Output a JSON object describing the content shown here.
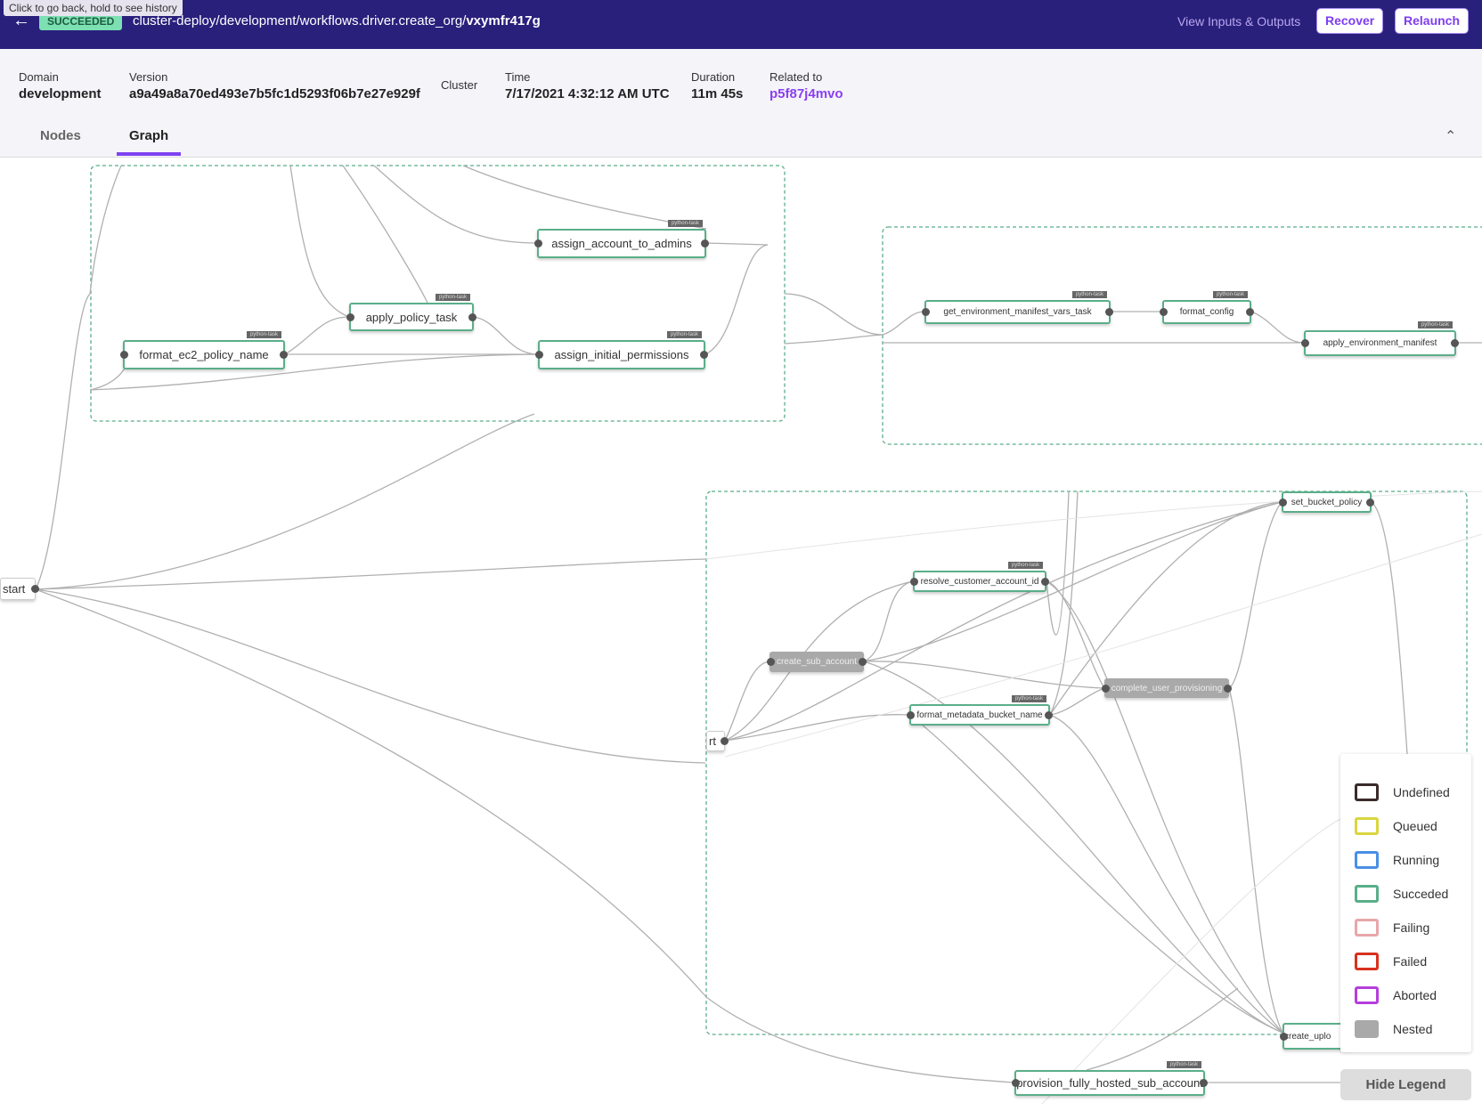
{
  "header": {
    "tooltip": "Click to go back, hold to see history",
    "status": "SUCCEEDED",
    "path_prefix": "cluster-deploy/development/workflows.driver.create_org/",
    "execution_id": "vxymfr417g",
    "view_io": "View Inputs & Outputs",
    "recover": "Recover",
    "relaunch": "Relaunch",
    "back_icon": "arrow-left-icon"
  },
  "info": {
    "domain_label": "Domain",
    "domain": "development",
    "version_label": "Version",
    "version": "a9a49a8a70ed493e7b5fc1d5293f06b7e27e929f",
    "cluster_label": "Cluster",
    "time_label": "Time",
    "time": "7/17/2021 4:32:12 AM UTC",
    "duration_label": "Duration",
    "duration": "11m 45s",
    "related_label": "Related to",
    "related": "p5f87j4mvo"
  },
  "tabs": [
    {
      "label": "Nodes"
    },
    {
      "label": "Graph",
      "active": true
    }
  ],
  "graph": {
    "task_tag": "python-task",
    "nodes": {
      "start": "start",
      "start2": "rt",
      "format_ec2": "format_ec2_policy_name",
      "apply_policy": "apply_policy_task",
      "assign_admins": "assign_account_to_admins",
      "assign_perm": "assign_initial_permissions",
      "get_env": "get_environment_manifest_vars_task",
      "format_config": "format_config",
      "apply_env": "apply_environment_manifest",
      "set_bucket": "set_bucket_policy",
      "resolve": "resolve_customer_account_id",
      "create_sub": "create_sub_account",
      "complete": "complete_user_provisioning",
      "format_meta": "format_metadata_bucket_name",
      "create_upload": "create_uplo",
      "provision": "provision_fully_hosted_sub_account"
    }
  },
  "legend": {
    "items": [
      {
        "label": "Undefined",
        "color": "#3a2a2a"
      },
      {
        "label": "Queued",
        "color": "#d9d640"
      },
      {
        "label": "Running",
        "color": "#4a8fe6"
      },
      {
        "label": "Succeded",
        "color": "#5aae89"
      },
      {
        "label": "Failing",
        "color": "#e8a7aa"
      },
      {
        "label": "Failed",
        "color": "#d8301e"
      },
      {
        "label": "Aborted",
        "color": "#b43fdc"
      },
      {
        "label": "Nested",
        "color": "#a9a9a9"
      }
    ],
    "hide": "Hide Legend"
  }
}
